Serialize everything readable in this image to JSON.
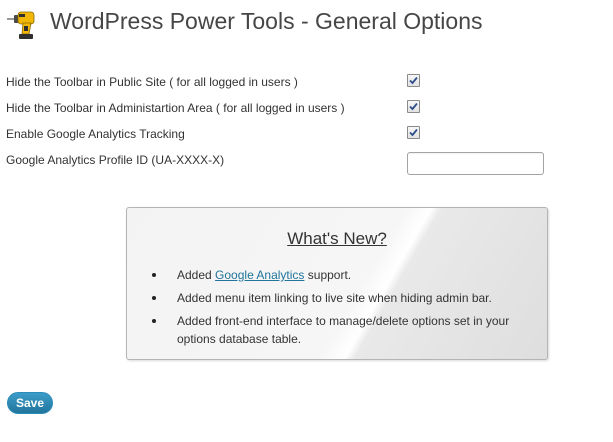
{
  "header": {
    "title": "WordPress Power Tools - General Options",
    "icon": "drill-icon"
  },
  "options": [
    {
      "label": "Hide the Toolbar in Public Site ( for all logged in users )",
      "checked": true
    },
    {
      "label": "Hide the Toolbar in Administartion Area ( for all logged in users )",
      "checked": true
    },
    {
      "label": "Enable Google Analytics Tracking",
      "checked": true
    }
  ],
  "analytics_field": {
    "label": "Google Analytics Profile ID (UA-XXXX-X)",
    "value": "",
    "placeholder": ""
  },
  "whats_new": {
    "title": "What's New?",
    "item1_prefix": "Added ",
    "item1_link": "Google Analytics",
    "item1_suffix": " support.",
    "item2": "Added menu item linking to live site when hiding admin bar.",
    "item3": "Added front-end interface to manage/delete options set in your options database table."
  },
  "save_label": "Save",
  "colors": {
    "link": "#21759b",
    "button": "#21759b",
    "title": "#464646"
  }
}
